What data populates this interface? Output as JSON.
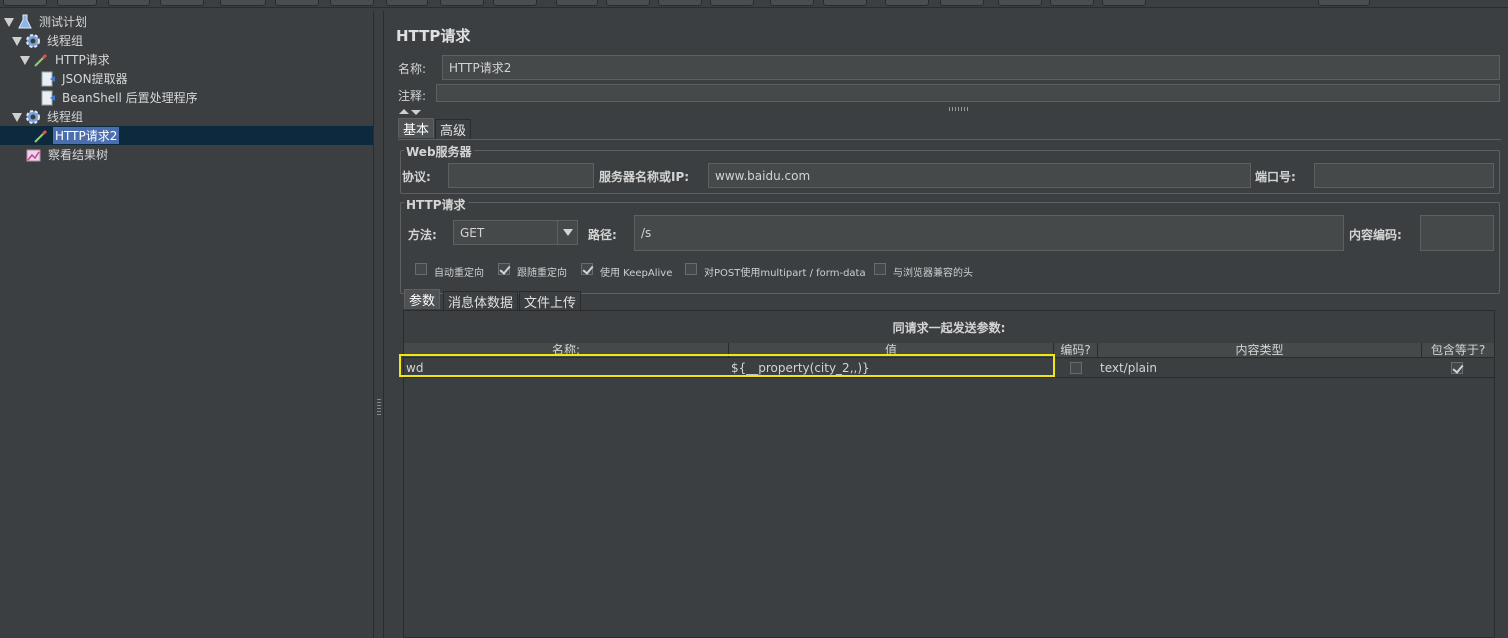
{
  "tree": {
    "items": [
      {
        "label": "测试计划",
        "icon": "flask-icon"
      },
      {
        "label": "线程组",
        "icon": "gear-icon"
      },
      {
        "label": "HTTP请求",
        "icon": "pipette-icon"
      },
      {
        "label": "JSON提取器",
        "icon": "extractor-icon"
      },
      {
        "label": "BeanShell 后置处理程序",
        "icon": "extractor-icon"
      },
      {
        "label": "线程组",
        "icon": "gear-icon"
      },
      {
        "label": "HTTP请求2",
        "icon": "pipette-icon"
      },
      {
        "label": "察看结果树",
        "icon": "chart-icon"
      }
    ]
  },
  "panel": {
    "title": "HTTP请求",
    "name_label": "名称:",
    "name_value": "HTTP请求2",
    "comment_label": "注释:",
    "comment_value": ""
  },
  "tabs": {
    "basic": "基本",
    "advanced": "高级"
  },
  "web_server": {
    "group_title": "Web服务器",
    "protocol_label": "协议:",
    "protocol_value": "",
    "server_label": "服务器名称或IP:",
    "server_value": "www.baidu.com",
    "port_label": "端口号:",
    "port_value": ""
  },
  "http_request": {
    "group_title": "HTTP请求",
    "method_label": "方法:",
    "method_value": "GET",
    "path_label": "路径:",
    "path_value": "/s",
    "encoding_label": "内容编码:",
    "encoding_value": ""
  },
  "options": [
    {
      "label": "自动重定向",
      "checked": false
    },
    {
      "label": "跟随重定向",
      "checked": true
    },
    {
      "label": "使用 KeepAlive",
      "checked": true
    },
    {
      "label": "对POST使用multipart / form-data",
      "checked": false
    },
    {
      "label": "与浏览器兼容的头",
      "checked": false
    }
  ],
  "param_tabs": {
    "params": "参数",
    "body": "消息体数据",
    "files": "文件上传"
  },
  "table": {
    "caption": "同请求一起发送参数:",
    "columns": [
      "名称:",
      "值",
      "编码?",
      "内容类型",
      "包含等于?"
    ],
    "rows": [
      {
        "name": "wd",
        "value": "${__property(city_2,,)}",
        "encode": false,
        "content_type": "text/plain",
        "include_equals": true
      }
    ]
  },
  "colors": {
    "background": "#3c3f41",
    "selection": "#4b6eaf",
    "highlight": "#f0e614"
  }
}
